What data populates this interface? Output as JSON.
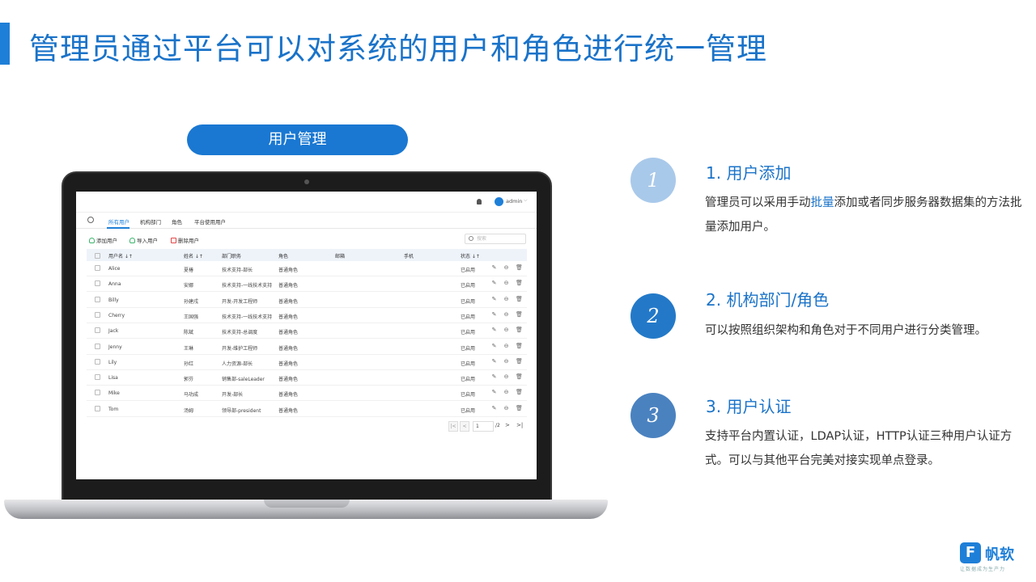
{
  "page": {
    "title": "管理员通过平台可以对系统的用户和角色进行统一管理",
    "section_label": "用户管理"
  },
  "app": {
    "admin_name": "admin",
    "tabs": [
      "所有用户",
      "机构部门",
      "角色",
      "平台使用用户"
    ],
    "toolbar": {
      "add_user": "添加用户",
      "import_user": "导入用户",
      "delete_user": "删除用户",
      "search_placeholder": "搜索"
    },
    "columns": [
      "用户名 ↓↑",
      "姓名 ↓↑",
      "部门职务",
      "角色",
      "邮箱",
      "手机",
      "状态 ↓↑"
    ],
    "rows": [
      {
        "username": "Alice",
        "name": "夏椿",
        "dept": "技术支持-部长",
        "role": "普通角色",
        "status": "已启用"
      },
      {
        "username": "Anna",
        "name": "安娜",
        "dept": "技术支持-一线技术支持",
        "role": "普通角色",
        "status": "已启用"
      },
      {
        "username": "Billy",
        "name": "孙建戌",
        "dept": "开发-开发工程师",
        "role": "普通角色",
        "status": "已启用"
      },
      {
        "username": "Cherry",
        "name": "王国强",
        "dept": "技术支持-一线技术支持",
        "role": "普通角色",
        "status": "已启用"
      },
      {
        "username": "Jack",
        "name": "陈斌",
        "dept": "技术支持-总调度",
        "role": "普通角色",
        "status": "已启用"
      },
      {
        "username": "Jenny",
        "name": "王琳",
        "dept": "开发-维护工程师",
        "role": "普通角色",
        "status": "已启用"
      },
      {
        "username": "Lily",
        "name": "孙红",
        "dept": "人力资源-部长",
        "role": "普通角色",
        "status": "已启用"
      },
      {
        "username": "Lisa",
        "name": "郭芬",
        "dept": "销售部-saleLeader",
        "role": "普通角色",
        "status": "已启用"
      },
      {
        "username": "Mike",
        "name": "马功成",
        "dept": "开发-部长",
        "role": "普通角色",
        "status": "已启用"
      },
      {
        "username": "Tom",
        "name": "汤姆",
        "dept": "领导部-president",
        "role": "普通角色",
        "status": "已启用"
      }
    ],
    "pager": {
      "current": "1",
      "total": "/2"
    }
  },
  "features": [
    {
      "number": "1",
      "title": "1. 用户添加",
      "desc_before": "管理员可以采用手动",
      "desc_highlight": "批量",
      "desc_after": "添加或者同步服务器数据集的方法批量添加用户。",
      "color": "#a9c9ea"
    },
    {
      "number": "2",
      "title": "2. 机构部门/角色",
      "desc": "可以按照组织架构和角色对于不同用户进行分类管理。",
      "color": "#2379c8"
    },
    {
      "number": "3",
      "title": "3. 用户认证",
      "desc": "支持平台内置认证，LDAP认证，HTTP认证三种用户认证方式。可以与其他平台完美对接实现单点登录。",
      "color": "#4a82c0"
    }
  ],
  "logo": {
    "mark": "F",
    "text": "帆软",
    "tagline": "让数据成为生产力"
  }
}
